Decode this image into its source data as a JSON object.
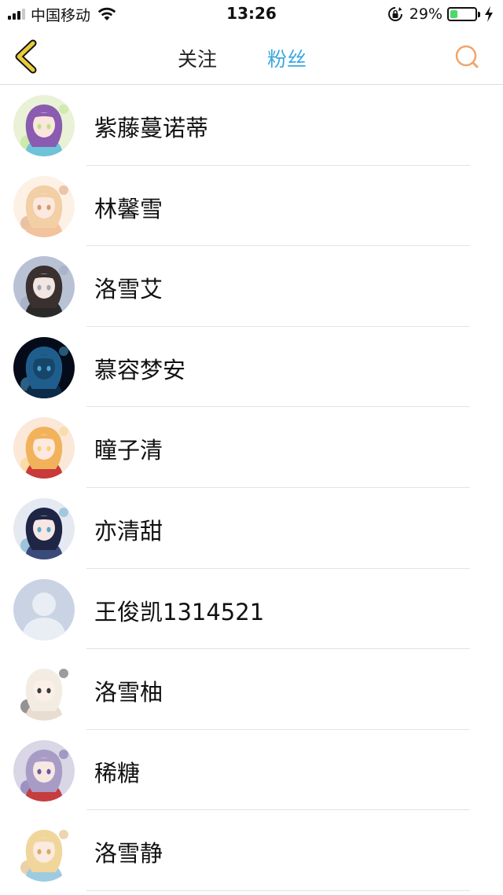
{
  "status_bar": {
    "carrier": "中国移动",
    "time": "13:26",
    "battery_percent_text": "29%",
    "battery_level": 0.29,
    "icons": [
      "signal-icon",
      "wifi-icon",
      "orientation-lock-icon",
      "battery-icon",
      "charging-icon"
    ]
  },
  "nav": {
    "back_icon": "chevron-left-icon",
    "tabs": [
      {
        "label": "关注",
        "active": false
      },
      {
        "label": "粉丝",
        "active": true
      }
    ],
    "search_icon": "search-icon",
    "colors": {
      "active_tab": "#3ca8e0",
      "back": "#e8cc3a",
      "search": "#f2a46a"
    }
  },
  "fans": [
    {
      "name": "紫藤蔓诺蒂",
      "avatar": "anime-girl-purple-hair"
    },
    {
      "name": "林馨雪",
      "avatar": "anime-girl-blonde-bow"
    },
    {
      "name": "洛雪艾",
      "avatar": "anime-girl-dark-hair"
    },
    {
      "name": "慕容梦安",
      "avatar": "dark-blue-fantasy"
    },
    {
      "name": "瞳子清",
      "avatar": "anime-girl-red-outfit"
    },
    {
      "name": "亦清甜",
      "avatar": "anime-girl-navy-hair"
    },
    {
      "name": "王俊凯1314521",
      "avatar": "default-person-placeholder"
    },
    {
      "name": "洛雪柚",
      "avatar": "anime-girl-fox-ears"
    },
    {
      "name": "稀糖",
      "avatar": "anime-girl-red-kimono"
    },
    {
      "name": "洛雪静",
      "avatar": "chibi-girl-bear-hat"
    }
  ]
}
